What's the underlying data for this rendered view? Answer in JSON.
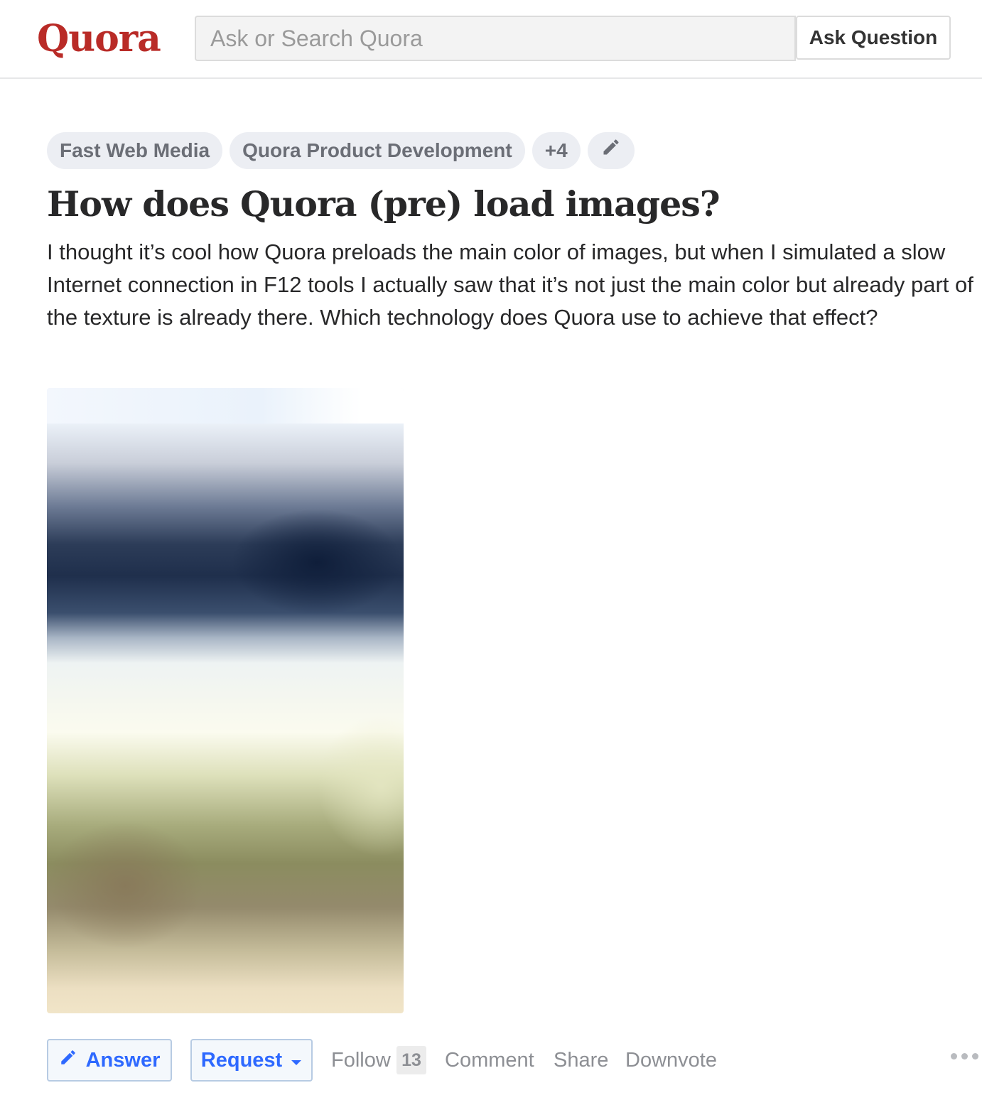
{
  "header": {
    "logo": "Quora",
    "search_placeholder": "Ask or Search Quora",
    "ask_button": "Ask Question"
  },
  "topics": [
    {
      "label": "Fast Web Media"
    },
    {
      "label": "Quora Product Development"
    },
    {
      "label": "+4"
    }
  ],
  "question": {
    "title": "How does Quora (pre) load images?",
    "details": "I thought it’s cool how Quora preloads the main color of images, but when I simulated a slow Internet connection in F12 tools I actually saw that it’s not just the main color but already part of the texture is already there. Which technology does Quora use to achieve that effect?"
  },
  "actions": {
    "answer": "Answer",
    "request": "Request",
    "follow": "Follow",
    "follow_count": "13",
    "comment": "Comment",
    "share": "Share",
    "downvote": "Downvote"
  },
  "colors": {
    "brand": "#b92b27",
    "link_blue": "#2e69ff",
    "topic_bg": "#eceef3"
  }
}
